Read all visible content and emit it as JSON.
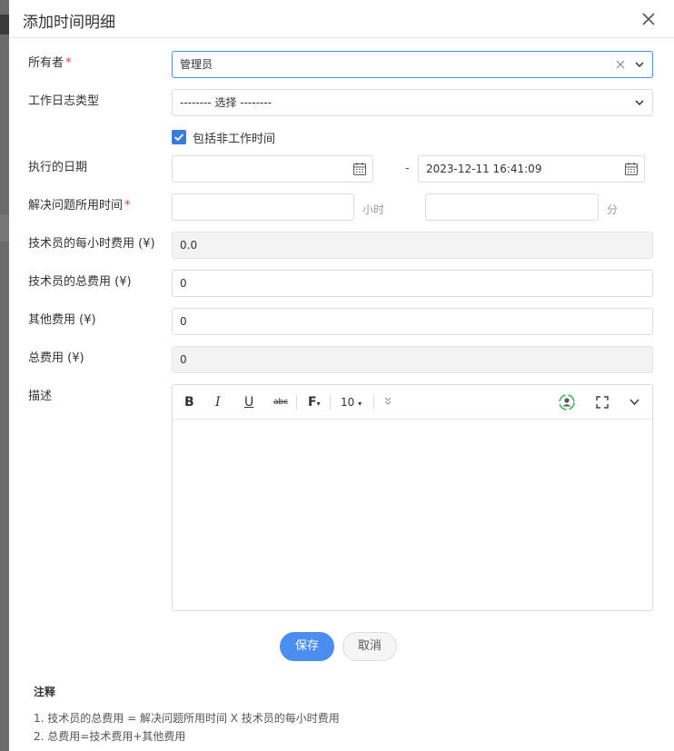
{
  "dialog": {
    "title": "添加时间明细"
  },
  "owner": {
    "label": "所有者",
    "required": "*",
    "value": "管理员"
  },
  "worklog_type": {
    "label": "工作日志类型",
    "value": "-------- 选择 --------"
  },
  "include_non_work": {
    "label": "包括非工作时间",
    "checked": true
  },
  "exec_date": {
    "label": "执行的日期",
    "start": "",
    "dash": "-",
    "end": "2023-12-11 16:41:09"
  },
  "solve_time": {
    "label": "解决问题所用时间",
    "required": "*",
    "hours": "",
    "hours_unit": "小时",
    "minutes": "",
    "minutes_unit": "分"
  },
  "tech_hourly_fee": {
    "label": "技术员的每小时费用 (¥)",
    "value": "0.0"
  },
  "tech_total_fee": {
    "label": "技术员的总费用 (¥)",
    "value": "0"
  },
  "other_fee": {
    "label": "其他费用 (¥)",
    "value": "0"
  },
  "total_fee": {
    "label": "总费用 (¥)",
    "value": "0"
  },
  "description": {
    "label": "描述",
    "toolbar": {
      "bold": "B",
      "italic": "I",
      "underline": "U",
      "strike": "abc",
      "font": "F",
      "size": "10"
    }
  },
  "actions": {
    "save": "保存",
    "cancel": "取消"
  },
  "notes": {
    "title": "注释",
    "items": [
      "1. 技术员的总费用 = 解决问题所用时间 X 技术员的每小时费用",
      "2. 总费用=技术费用+其他费用"
    ]
  }
}
